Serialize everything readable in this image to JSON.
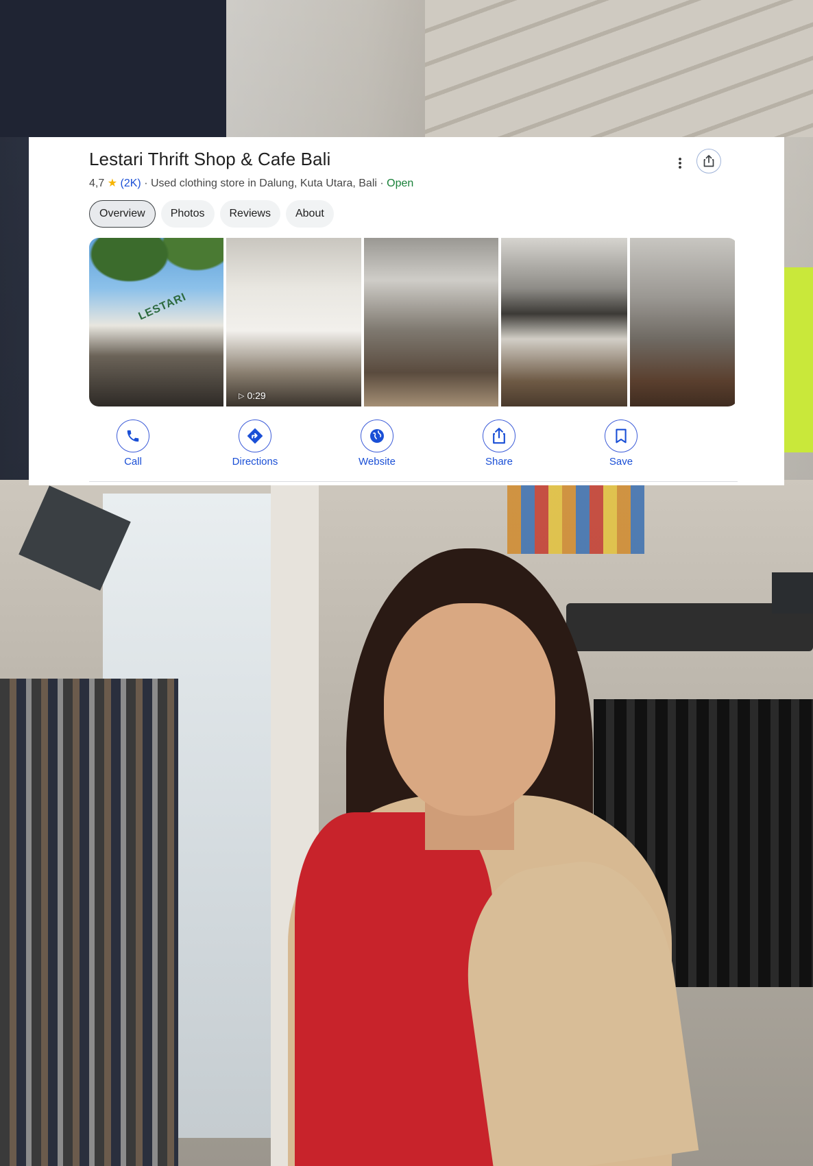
{
  "place": {
    "name": "Lestari Thrift Shop & Cafe Bali",
    "rating": "4,7",
    "review_count": "(2K)",
    "category_location": "Used clothing store in Dalung, Kuta Utara, Bali",
    "separator": "·",
    "status": "Open",
    "status_color": "#188038"
  },
  "tabs": [
    {
      "label": "Overview",
      "active": true
    },
    {
      "label": "Photos",
      "active": false
    },
    {
      "label": "Reviews",
      "active": false
    },
    {
      "label": "About",
      "active": false
    }
  ],
  "photos": {
    "video_duration": "0:29"
  },
  "actions": [
    {
      "label": "Call",
      "icon": "phone-icon"
    },
    {
      "label": "Directions",
      "icon": "directions-icon"
    },
    {
      "label": "Website",
      "icon": "globe-icon"
    },
    {
      "label": "Share",
      "icon": "share-icon"
    },
    {
      "label": "Save",
      "icon": "bookmark-icon"
    }
  ],
  "colors": {
    "accent": "#1a4fd6",
    "star": "#f6b400"
  }
}
